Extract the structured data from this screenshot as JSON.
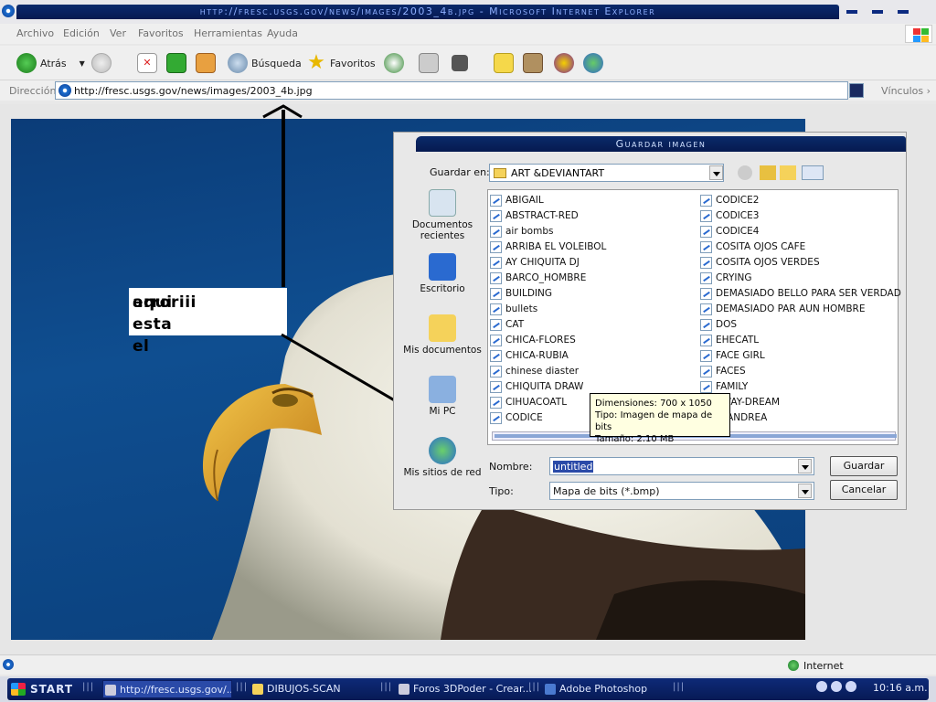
{
  "window": {
    "title": "http://fresc.usgs.gov/news/images/2003_4b.jpg - Microsoft Internet Explorer"
  },
  "menu": [
    "Archivo",
    "Edición",
    "Ver",
    "Favoritos",
    "Herramientas",
    "Ayuda"
  ],
  "toolbar": {
    "back": "Atrás",
    "search": "Búsqueda",
    "favorites": "Favoritos"
  },
  "address": {
    "label": "Dirección",
    "url": "http://fresc.usgs.gov/news/images/2003_4b.jpg",
    "links": "Vínculos"
  },
  "annotation": {
    "line1": "aqui esta el",
    "line2": "erroriii"
  },
  "dialog": {
    "title": "Guardar imagen",
    "save_in_label": "Guardar en:",
    "save_in_value": "ART &DEVIANTART",
    "places": [
      "Documentos recientes",
      "Escritorio",
      "Mis documentos",
      "Mi PC",
      "Mis sitios de red"
    ],
    "files_col1": [
      "ABIGAIL",
      "ABSTRACT-RED",
      "air bombs",
      "ARRIBA EL VOLEIBOL",
      "AY CHIQUITA DJ",
      "BARCO_HOMBRE",
      "BUILDING",
      "bullets",
      "CAT",
      "CHICA-FLORES",
      "CHICA-RUBIA",
      "chinese diaster",
      "CHIQUITA DRAW",
      "CIHUACOATL",
      "CODICE"
    ],
    "files_col2": [
      "CODICE2",
      "CODICE3",
      "CODICE4",
      "COSITA OJOS CAFE",
      "COSITA OJOS VERDES",
      "CRYING",
      "DEMASIADO BELLO PARA SER VERDAD",
      "DEMASIADO PAR AUN HOMBRE",
      "DOS",
      "EHECATL",
      "FACE GIRL",
      "FACES",
      "FAMILY",
      "AWAY-DREAM",
      "O-ANDREA"
    ],
    "tooltip": {
      "dims": "Dimensiones: 700 x 1050",
      "type": "Tipo: Imagen de mapa de bits",
      "size": "Tamaño: 2.10 MB"
    },
    "name_label": "Nombre:",
    "name_value": "untitled",
    "type_label": "Tipo:",
    "type_value": "Mapa de bits (*.bmp)",
    "save_button": "Guardar",
    "cancel_button": "Cancelar"
  },
  "status": {
    "zone": "Internet"
  },
  "taskbar": {
    "start": "START",
    "tasks": [
      "http://fresc.usgs.gov/...",
      "DIBUJOS-SCAN",
      "Foros 3DPoder - Crear...",
      "Adobe Photoshop"
    ],
    "clock": "10:16 a.m."
  }
}
